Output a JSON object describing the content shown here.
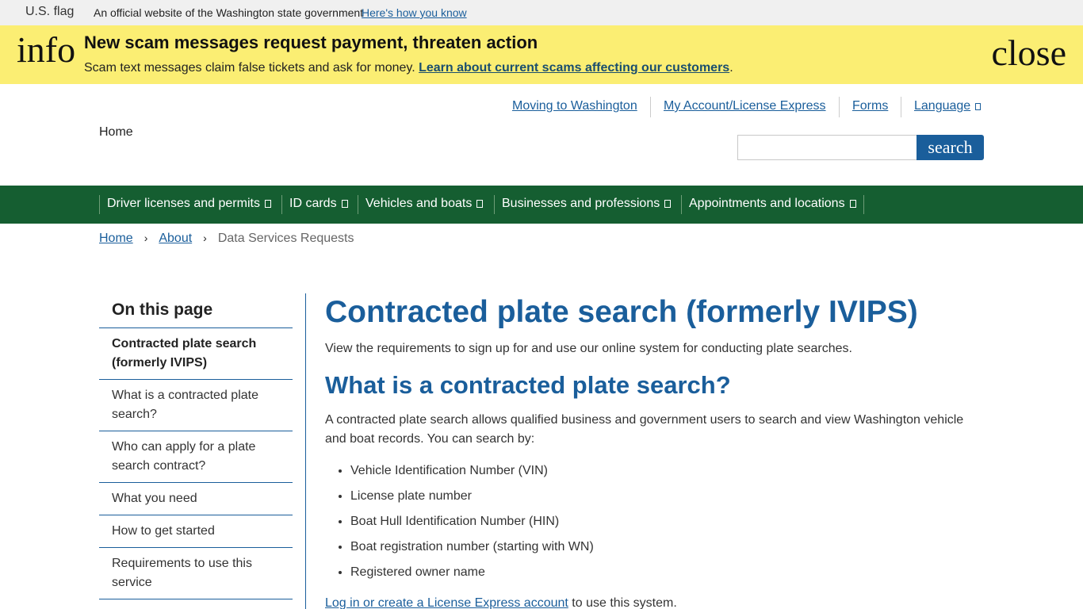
{
  "gov_banner": {
    "flag_alt": "U.S. flag",
    "text": "An official website of the Washington state government",
    "link": "Here's how you know"
  },
  "alert": {
    "icon": "info",
    "title": "New scam messages request payment, threaten action",
    "body": "Scam text messages claim false tickets and ask for money. ",
    "link": "Learn about current scams affecting our customers",
    "suffix": ".",
    "close": "close"
  },
  "header": {
    "util_links": [
      "Moving to Washington",
      "My Account/License Express",
      "Forms",
      "Language"
    ],
    "home_alt": "Home",
    "search_value": "",
    "search_button": "search"
  },
  "nav": {
    "items": [
      "Driver licenses and permits",
      "ID cards",
      "Vehicles and boats",
      "Businesses and professions",
      "Appointments and locations"
    ]
  },
  "breadcrumb": {
    "home": "Home",
    "about": "About",
    "current": "Data Services Requests",
    "sep": "›"
  },
  "sidebar": {
    "title": "On this page",
    "items": [
      "Contracted plate search (formerly IVIPS)",
      "What is a contracted plate search?",
      "Who can apply for a plate search contract?",
      "What you need",
      "How to get started",
      "Requirements to use this service"
    ]
  },
  "content": {
    "h1": "Contracted plate search (formerly IVIPS)",
    "lead": "View the requirements to sign up for and use our online system for conducting plate searches.",
    "h2": "What is a contracted plate search?",
    "para": "A contracted plate search allows qualified business and government users to search and view Washington vehicle and boat records. You can search by:",
    "list": [
      "Vehicle Identification Number (VIN)",
      "License plate number",
      "Boat Hull Identification Number (HIN)",
      "Boat registration number (starting with WN)",
      "Registered owner name"
    ],
    "last_link": "Log in or create a License Express account",
    "last_text": " to use this system."
  }
}
